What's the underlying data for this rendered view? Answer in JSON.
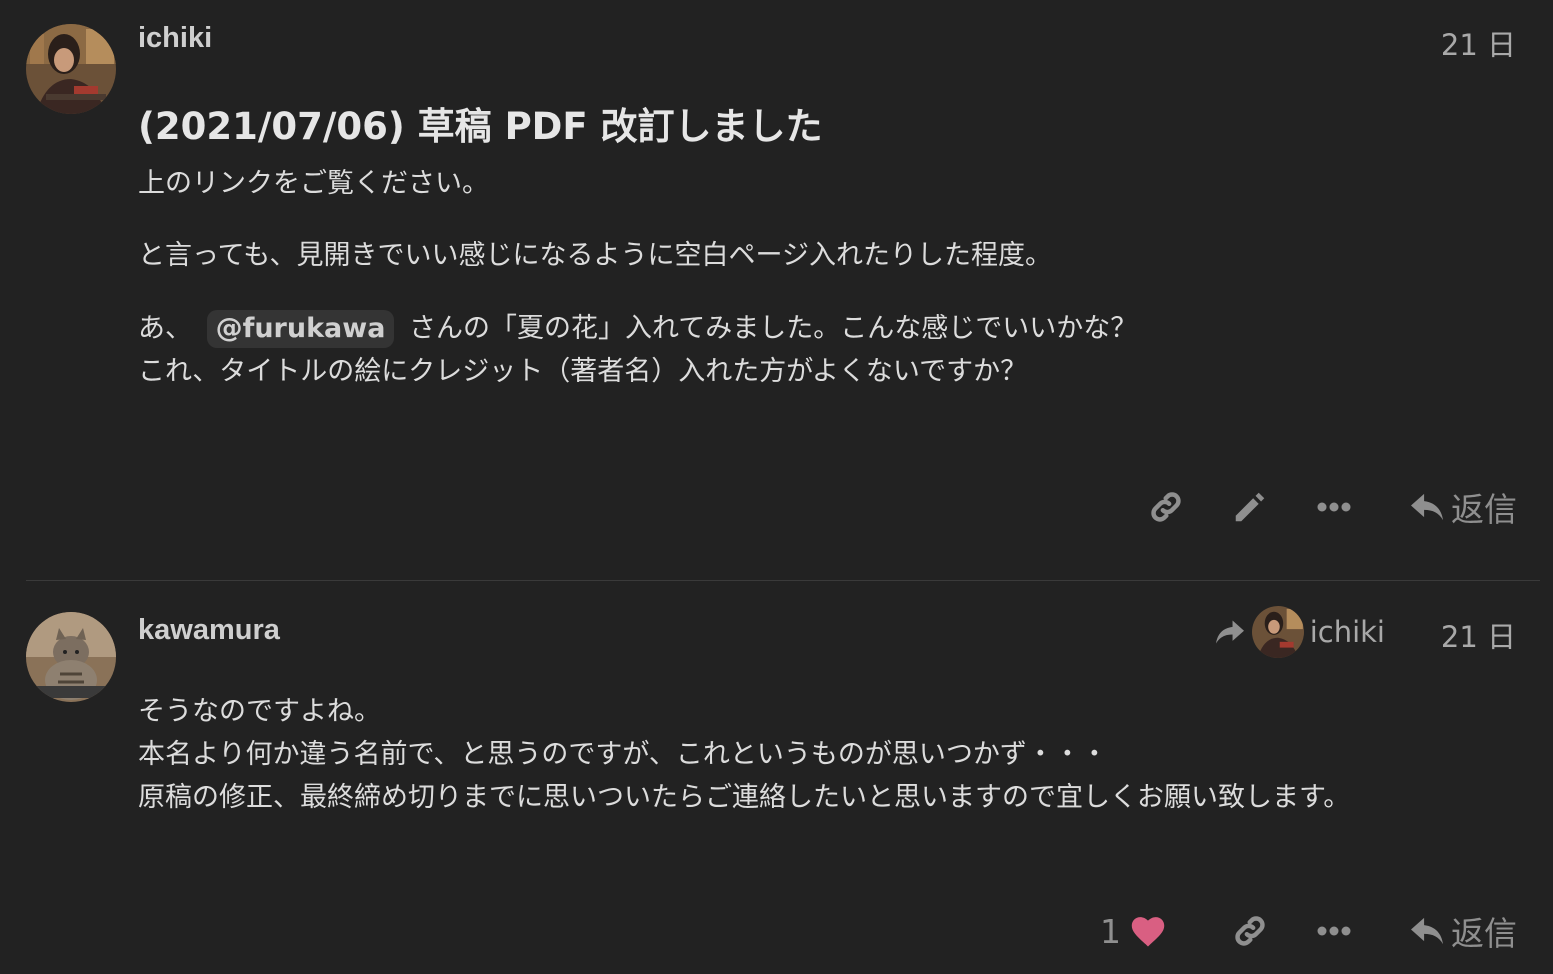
{
  "posts": [
    {
      "username": "ichiki",
      "date": "21 日",
      "heading": "(2021/07/06) 草稿 PDF 改訂しました",
      "paragraphs": [
        "上のリンクをご覧ください。",
        "と言っても、見開きでいい感じになるように空白ページ入れたりした程度。"
      ],
      "para3_before": "あ、",
      "mention": "@furukawa",
      "para3_after": "さんの「夏の花」入れてみました。こんな感じでいいかな？",
      "para4": "これ、タイトルの絵にクレジット（著者名）入れた方がよくないですか？",
      "reply_label": "返信",
      "icons": [
        "link-icon",
        "pencil-icon",
        "more-icon",
        "reply-icon"
      ]
    },
    {
      "username": "kawamura",
      "date": "21 日",
      "reply_to_username": "ichiki",
      "lines": [
        "そうなのですよね。",
        "本名より何か違う名前で、と思うのですが、これというものが思いつかず・・・",
        "原稿の修正、最終締め切りまでに思いついたらご連絡したいと思いますので宜しくお願い致します。"
      ],
      "like_count": "1",
      "reply_label": "返信",
      "icons": [
        "heart-icon",
        "link-icon",
        "more-icon",
        "reply-icon"
      ]
    }
  ],
  "colors": {
    "background": "#222222",
    "heart": "#d95f82",
    "muted_icon": "#8f8f8f"
  }
}
